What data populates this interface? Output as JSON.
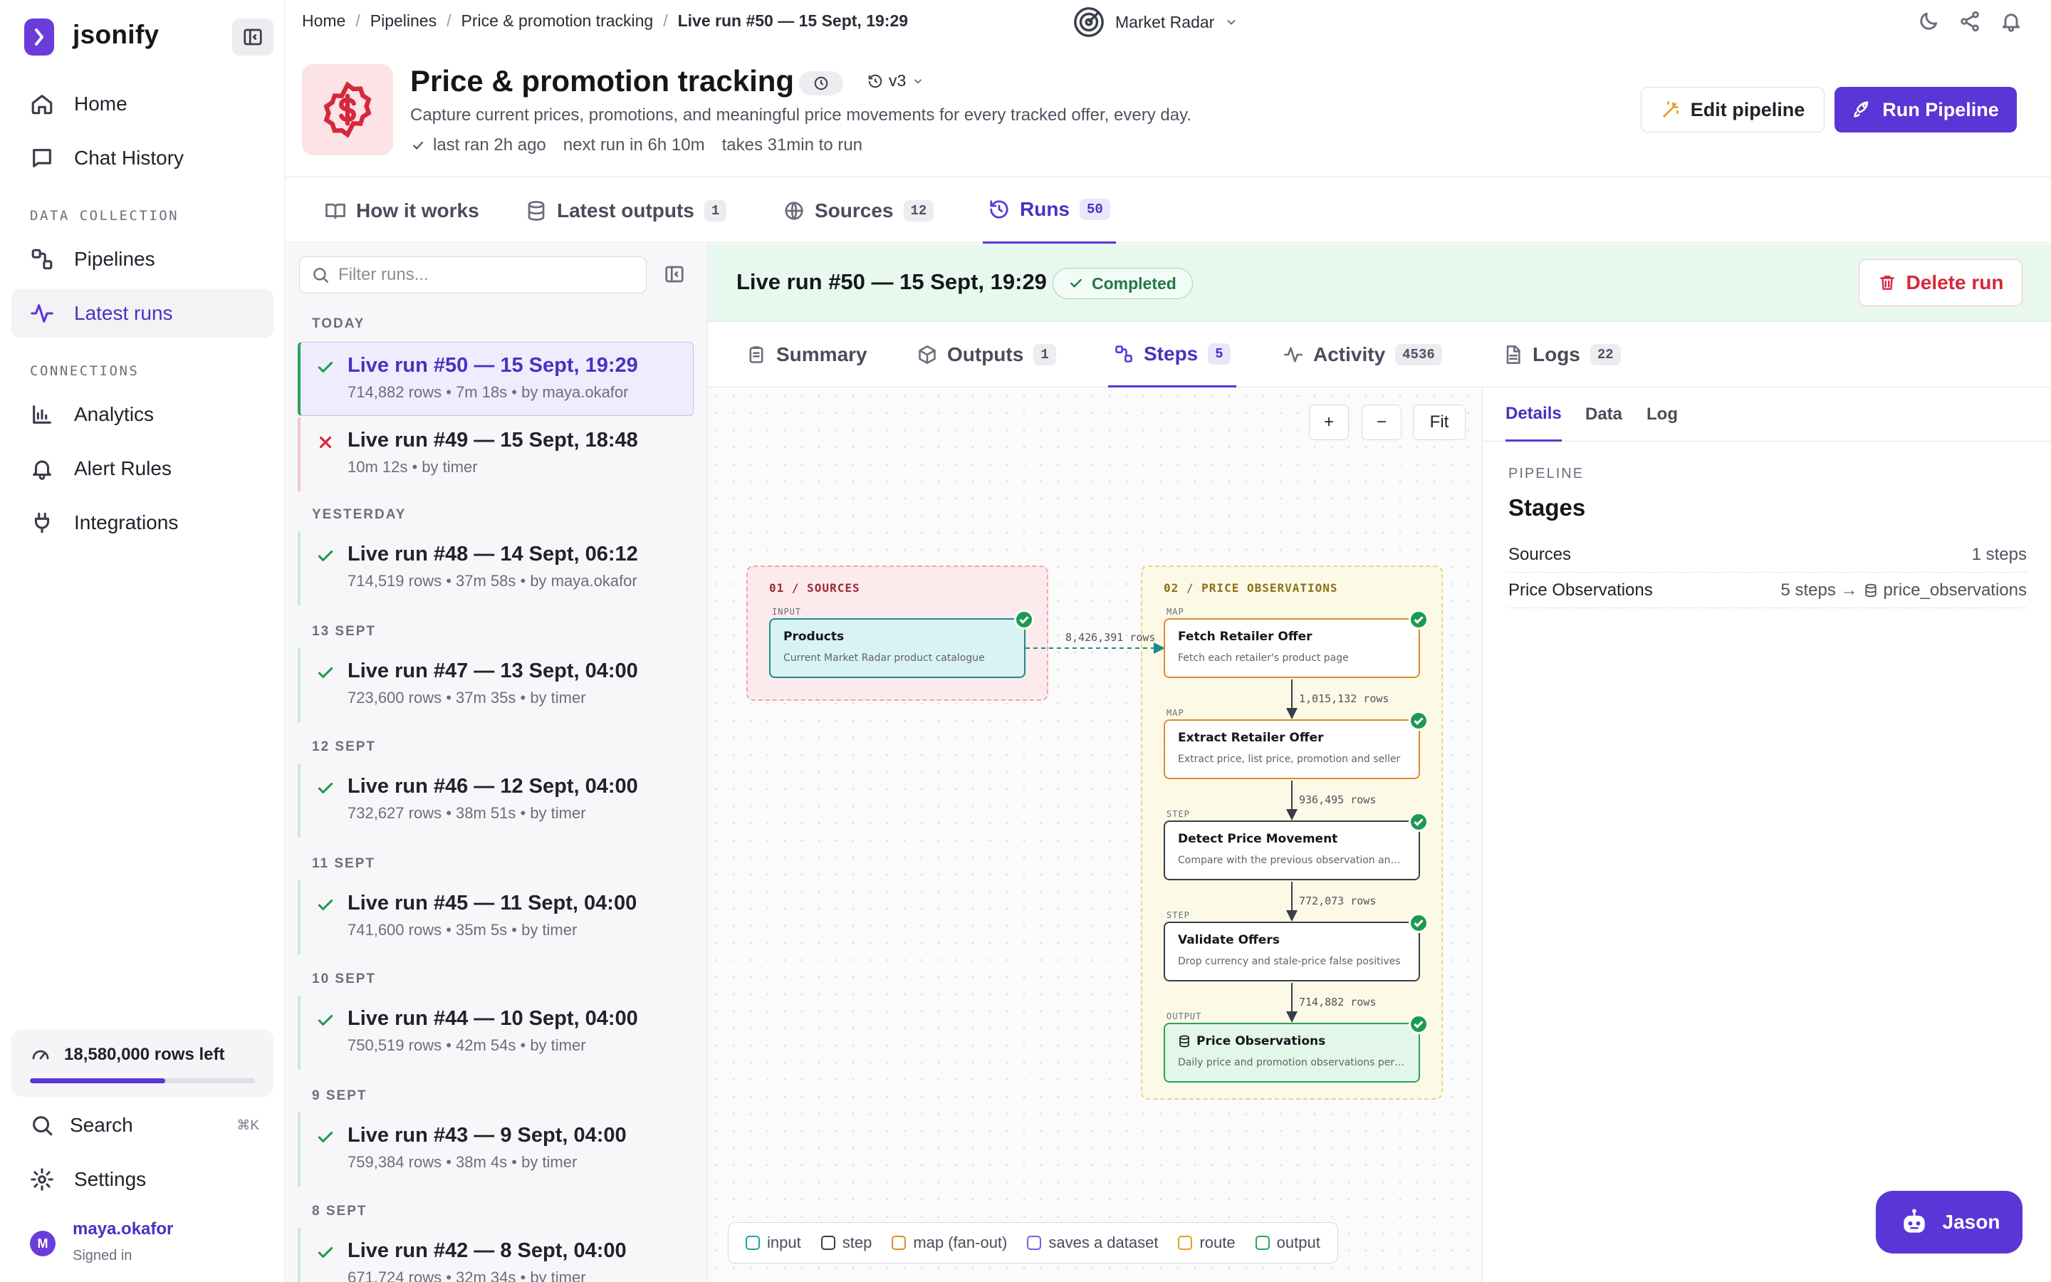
{
  "app": {
    "name": "jsonify"
  },
  "sidebar": {
    "nav": [
      {
        "label": "Home"
      },
      {
        "label": "Chat History"
      }
    ],
    "data_collection_label": "DATA COLLECTION",
    "data_collection": [
      {
        "label": "Pipelines"
      },
      {
        "label": "Latest runs"
      }
    ],
    "connections_label": "CONNECTIONS",
    "connections": [
      {
        "label": "Analytics"
      },
      {
        "label": "Alert Rules"
      },
      {
        "label": "Integrations"
      }
    ],
    "rows_left": "18,580,000 rows left",
    "rows_left_fraction": 0.6,
    "search_label": "Search",
    "search_shortcut": "⌘K",
    "settings_label": "Settings",
    "user": {
      "initial": "M",
      "name": "maya.okafor",
      "status": "Signed in"
    }
  },
  "breadcrumb": [
    "Home",
    "Pipelines",
    "Price & promotion tracking",
    "Live run #50 — 15 Sept, 19:29"
  ],
  "workspace": "Market Radar",
  "pipeline": {
    "title": "Price & promotion tracking",
    "version": "v3",
    "description": "Capture current prices, promotions, and meaningful price movements for every tracked offer, every day.",
    "last_ran": "last ran 2h ago",
    "next_run": "next run in 6h 10m",
    "duration": "takes 31min to run",
    "edit_label": "Edit pipeline",
    "run_label": "Run Pipeline"
  },
  "main_tabs": [
    {
      "label": "How it works",
      "count": ""
    },
    {
      "label": "Latest outputs",
      "count": "1"
    },
    {
      "label": "Sources",
      "count": "12"
    },
    {
      "label": "Runs",
      "count": "50"
    }
  ],
  "runs_list": {
    "filter_placeholder": "Filter runs...",
    "groups": [
      {
        "day": "TODAY",
        "runs": [
          {
            "title": "Live run #50 — 15 Sept, 19:29",
            "meta": "714,882 rows • 7m 18s • by maya.okafor",
            "status": "success"
          },
          {
            "title": "Live run #49 — 15 Sept, 18:48",
            "meta": "10m 12s • by timer",
            "status": "failed"
          }
        ]
      },
      {
        "day": "YESTERDAY",
        "runs": [
          {
            "title": "Live run #48 — 14 Sept, 06:12",
            "meta": "714,519 rows • 37m 58s • by maya.okafor",
            "status": "success"
          }
        ]
      },
      {
        "day": "13 SEPT",
        "runs": [
          {
            "title": "Live run #47 — 13 Sept, 04:00",
            "meta": "723,600 rows • 37m 35s • by timer",
            "status": "success"
          }
        ]
      },
      {
        "day": "12 SEPT",
        "runs": [
          {
            "title": "Live run #46 — 12 Sept, 04:00",
            "meta": "732,627 rows • 38m 51s • by timer",
            "status": "success"
          }
        ]
      },
      {
        "day": "11 SEPT",
        "runs": [
          {
            "title": "Live run #45 — 11 Sept, 04:00",
            "meta": "741,600 rows • 35m 5s • by timer",
            "status": "success"
          }
        ]
      },
      {
        "day": "10 SEPT",
        "runs": [
          {
            "title": "Live run #44 — 10 Sept, 04:00",
            "meta": "750,519 rows • 42m 54s • by timer",
            "status": "success"
          }
        ]
      },
      {
        "day": "9 SEPT",
        "runs": [
          {
            "title": "Live run #43 — 9 Sept, 04:00",
            "meta": "759,384 rows • 38m 4s • by timer",
            "status": "success"
          }
        ]
      },
      {
        "day": "8 SEPT",
        "runs": [
          {
            "title": "Live run #42 — 8 Sept, 04:00",
            "meta": "671,724 rows • 32m 34s • by timer",
            "status": "success"
          }
        ]
      }
    ]
  },
  "run_detail": {
    "title": "Live run #50 — 15 Sept, 19:29",
    "status": "Completed",
    "delete_label": "Delete run",
    "tabs": [
      {
        "label": "Summary",
        "count": ""
      },
      {
        "label": "Outputs",
        "count": "1"
      },
      {
        "label": "Steps",
        "count": "5"
      },
      {
        "label": "Activity",
        "count": "4536"
      },
      {
        "label": "Logs",
        "count": "22"
      }
    ]
  },
  "graph": {
    "zoom_in": "+",
    "zoom_out": "−",
    "fit": "Fit",
    "groups": [
      {
        "label": "01 / SOURCES"
      },
      {
        "label": "02 / PRICE OBSERVATIONS"
      }
    ],
    "nodes": [
      {
        "kind": "INPUT",
        "title": "Products",
        "desc": "Current Market Radar product catalogue"
      },
      {
        "kind": "MAP",
        "title": "Fetch Retailer Offer",
        "desc": "Fetch each retailer's product page"
      },
      {
        "kind": "MAP",
        "title": "Extract Retailer Offer",
        "desc": "Extract price, list price, promotion and seller"
      },
      {
        "kind": "STEP",
        "title": "Detect Price Movement",
        "desc": "Compare with the previous observation and fl..."
      },
      {
        "kind": "STEP",
        "title": "Validate Offers",
        "desc": "Drop currency and stale-price false positives"
      },
      {
        "kind": "OUTPUT",
        "title": "Price Observations",
        "desc": "Daily price and promotion observations per ret..."
      }
    ],
    "edges": [
      "8,426,391 rows",
      "1,015,132 rows",
      "936,495 rows",
      "772,073 rows",
      "714,882 rows"
    ],
    "legend": [
      {
        "label": "input",
        "color": "#1aa3a8"
      },
      {
        "label": "step",
        "color": "#3a3d4a"
      },
      {
        "label": "map (fan-out)",
        "color": "#e08a2e"
      },
      {
        "label": "saves a dataset",
        "color": "#7b5be0"
      },
      {
        "label": "route",
        "color": "#e0a020"
      },
      {
        "label": "output",
        "color": "#2aa35a"
      }
    ]
  },
  "details_panel": {
    "tabs": [
      "Details",
      "Data",
      "Log"
    ],
    "section_label": "PIPELINE",
    "title": "Stages",
    "stages": [
      {
        "name": "Sources",
        "value": "1 steps",
        "dataset": ""
      },
      {
        "name": "Price Observations",
        "value": "5 steps →",
        "dataset": "price_observations"
      }
    ]
  },
  "assistant": {
    "label": "Jason"
  }
}
